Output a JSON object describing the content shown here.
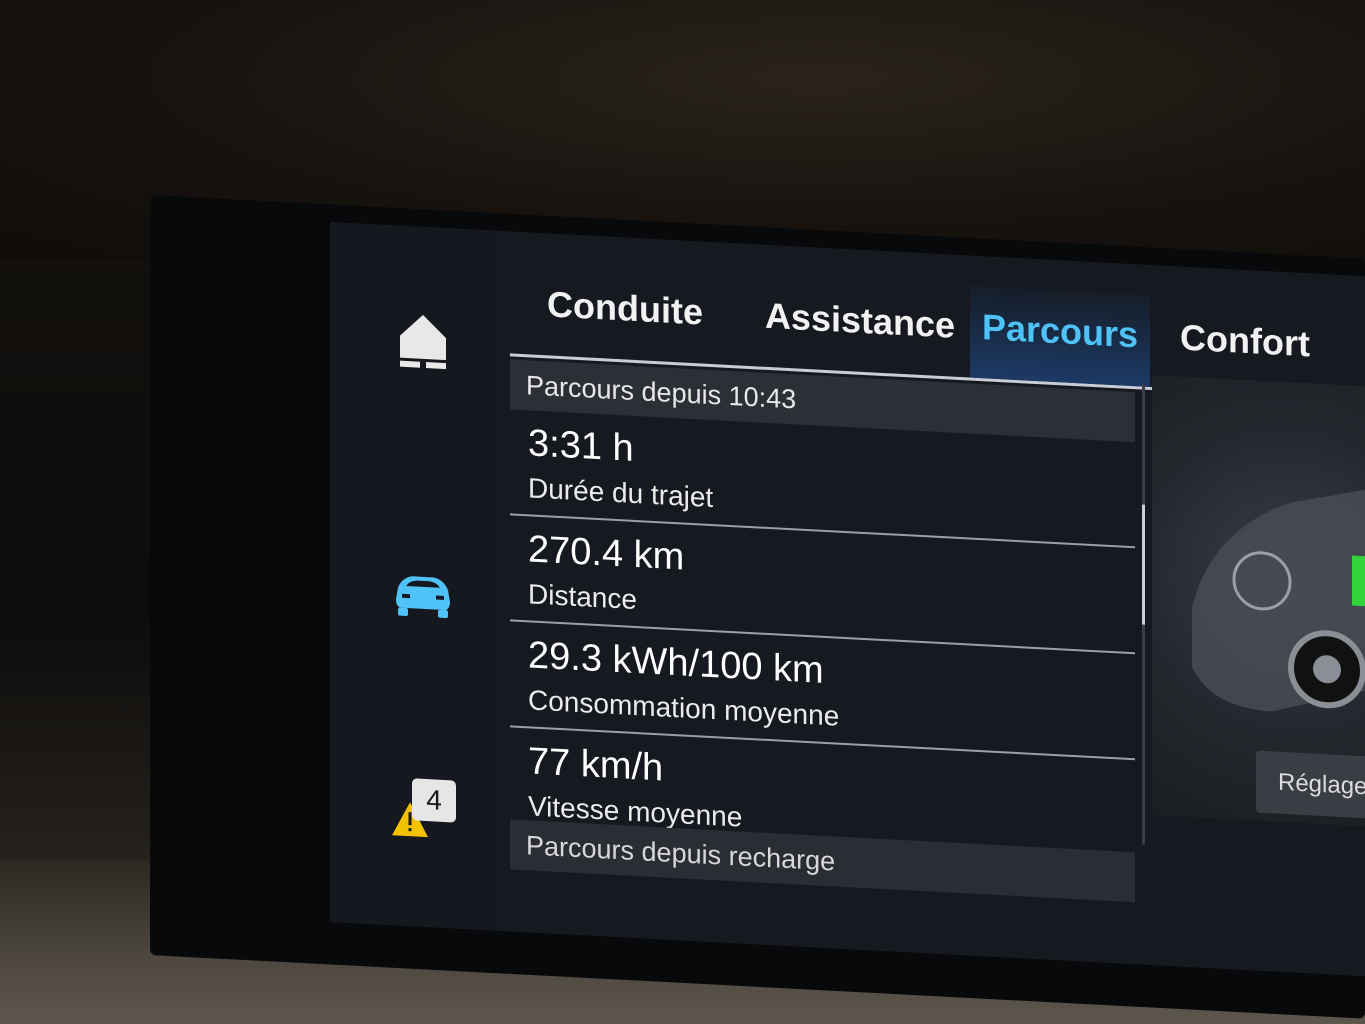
{
  "tabs": [
    {
      "label": "Conduite",
      "active": false
    },
    {
      "label": "Assistance",
      "active": false
    },
    {
      "label": "Parcours",
      "active": true
    },
    {
      "label": "Confort",
      "active": false
    }
  ],
  "section_header": "Parcours depuis 10:43",
  "rows": [
    {
      "value": "3:31 h",
      "label": "Durée du trajet"
    },
    {
      "value": "270.4 km",
      "label": "Distance"
    },
    {
      "value": "29.3 kWh/100 km",
      "label": "Consommation moyenne"
    },
    {
      "value": "77 km/h",
      "label": "Vitesse moyenne"
    }
  ],
  "section_footer": "Parcours depuis recharge",
  "rail": {
    "home_icon": "home-icon",
    "car_icon": "car-icon",
    "alert_icon": "warning-icon",
    "alert_count": "4"
  },
  "side": {
    "settings_button": "Réglages c"
  },
  "colors": {
    "accent": "#4fc3f7",
    "active_tab_bg": "#1c3a66",
    "screen_bg": "#161a20",
    "warning": "#f2c200"
  }
}
